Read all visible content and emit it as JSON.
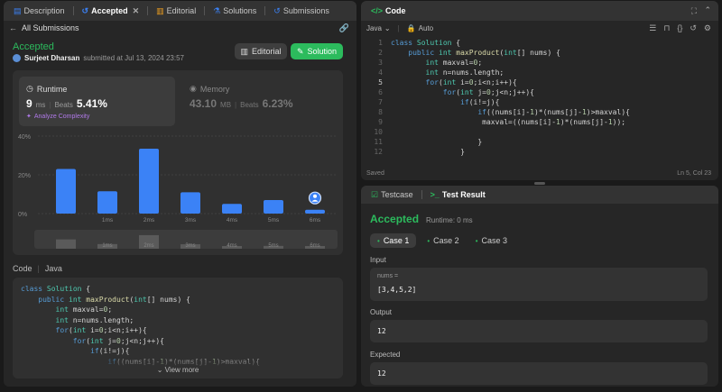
{
  "left": {
    "tabs": [
      {
        "label": "Description"
      },
      {
        "label": "Accepted"
      },
      {
        "label": "Editorial"
      },
      {
        "label": "Solutions"
      },
      {
        "label": "Submissions"
      }
    ],
    "back_label": "All Submissions",
    "status": "Accepted",
    "author": "Surjeet Dharsan",
    "submitted_text": "submitted at Jul 13, 2024 23:57",
    "editorial_button": "Editorial",
    "solution_button": "Solution",
    "runtime": {
      "title": "Runtime",
      "value": "9",
      "unit": "ms",
      "beats_label": "Beats",
      "beats_value": "5.41%",
      "analyze": "Analyze Complexity"
    },
    "memory": {
      "title": "Memory",
      "value": "43.10",
      "unit": "MB",
      "beats_label": "Beats",
      "beats_value": "6.23%"
    },
    "code_label": "Code",
    "code_lang": "Java",
    "view_more": "View more"
  },
  "chart_data": {
    "type": "bar",
    "ylabels": [
      "40%",
      "20%",
      "0%"
    ],
    "ylim": [
      0,
      40
    ],
    "categories": [
      "",
      "1ms",
      "2ms",
      "3ms",
      "4ms",
      "5ms",
      "6ms"
    ],
    "values": [
      23,
      11.5,
      33.5,
      11,
      5,
      7,
      2
    ],
    "highlight_index": 6,
    "bar_color": "#3b82f6",
    "mini_labels": [
      "",
      "1ms",
      "2ms",
      "3ms",
      "4ms",
      "5ms",
      "6ms"
    ]
  },
  "right": {
    "code_title": "Code",
    "lang": "Java",
    "auto": "Auto",
    "saved": "Saved",
    "cursor": "Ln 5, Col 23",
    "testcase_tab": "Testcase",
    "result_tab": "Test Result",
    "result_status": "Accepted",
    "result_runtime": "Runtime: 0 ms",
    "cases": [
      "Case 1",
      "Case 2",
      "Case 3"
    ],
    "input_label": "Input",
    "input_var": "nums =",
    "input_value": "[3,4,5,2]",
    "output_label": "Output",
    "output_value": "12",
    "expected_label": "Expected",
    "expected_value": "12"
  },
  "colors": {
    "accent_green": "#2cbb5d",
    "bar_blue": "#3b82f6",
    "panel": "#262626",
    "bg": "#1a1a1a"
  }
}
